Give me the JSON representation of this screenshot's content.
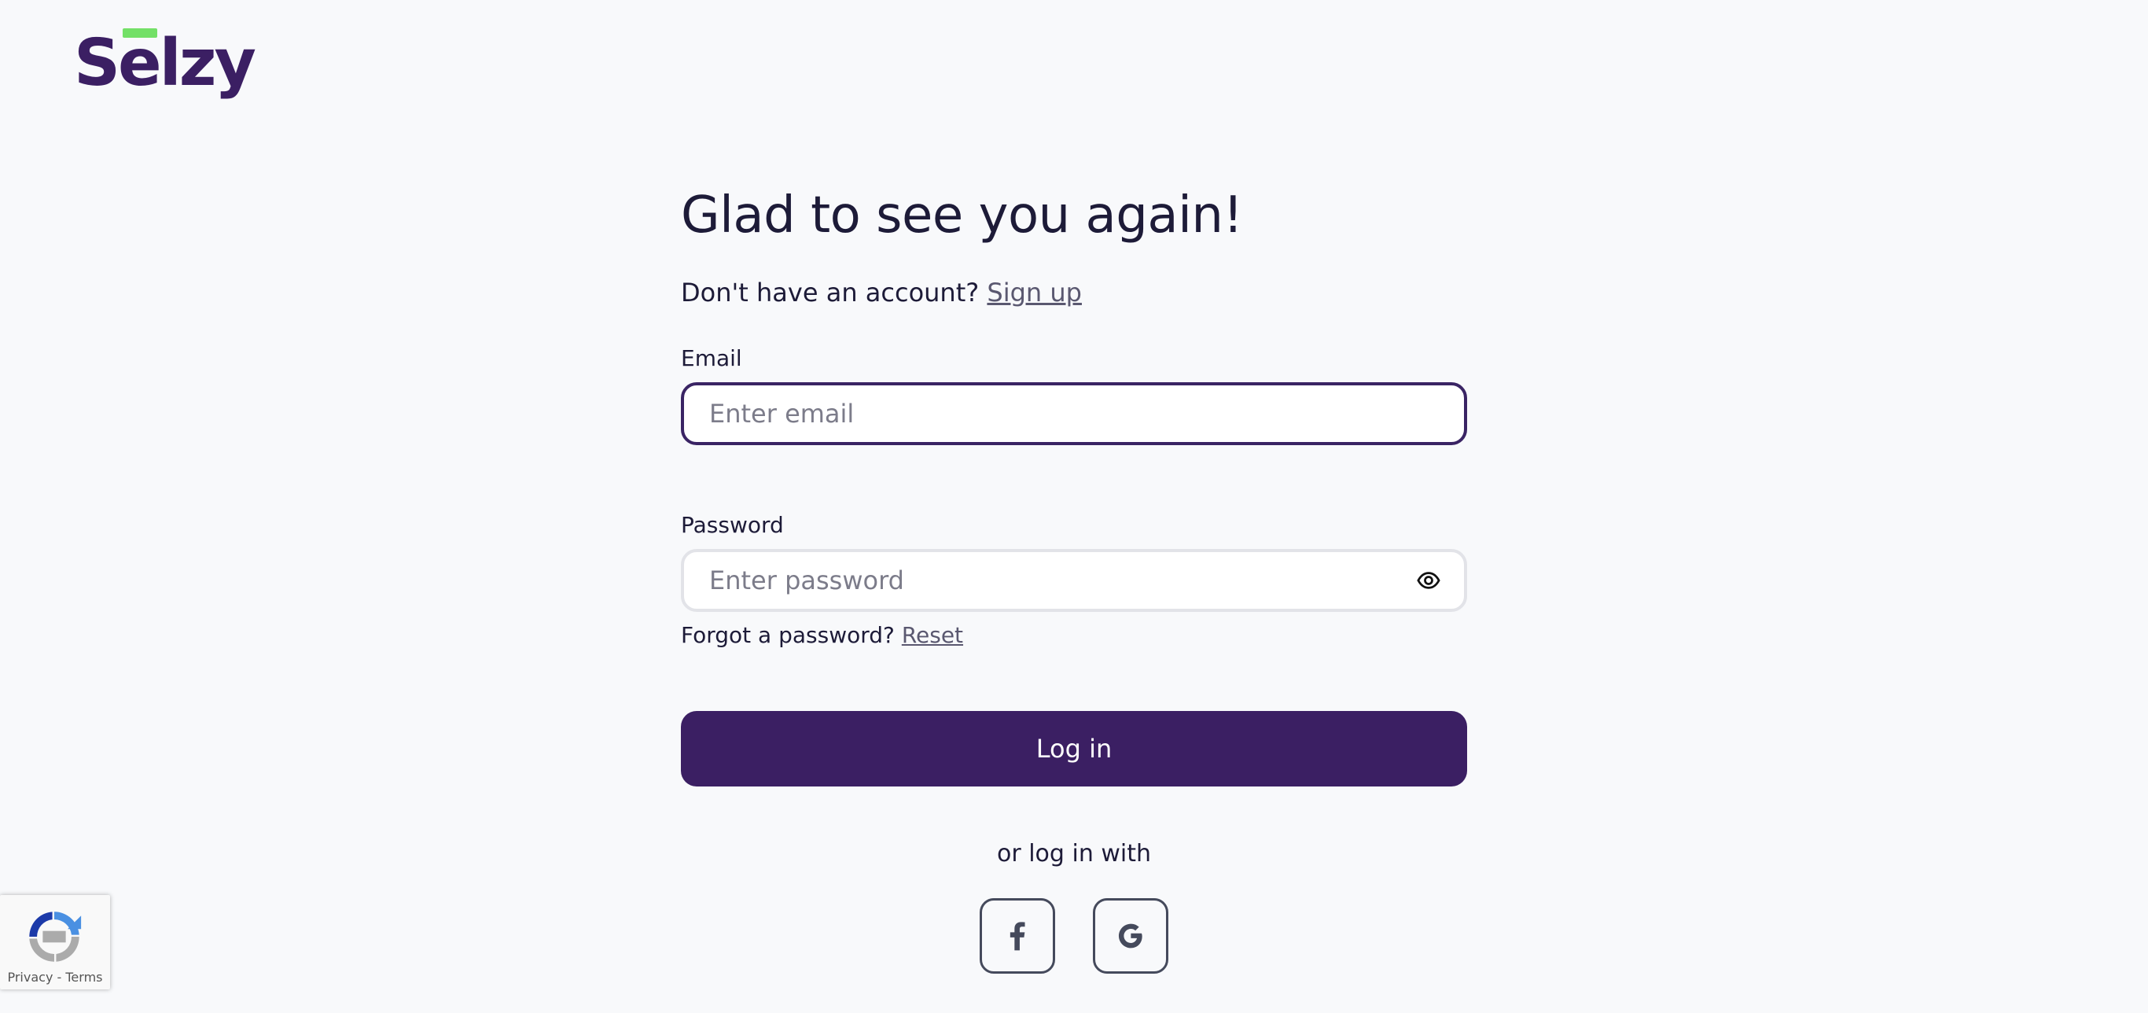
{
  "brand": {
    "name": "Selzy",
    "primary_color": "#3b1f63",
    "accent_color": "#73e067"
  },
  "heading": "Glad to see you again!",
  "signup": {
    "prompt": "Don't have an account?",
    "link": "Sign up"
  },
  "email": {
    "label": "Email",
    "placeholder": "Enter email",
    "value": ""
  },
  "password": {
    "label": "Password",
    "placeholder": "Enter password",
    "value": "",
    "toggle_icon": "eye-icon"
  },
  "forgot": {
    "prompt": "Forgot a password?",
    "link": "Reset"
  },
  "login_button": "Log in",
  "social": {
    "prompt": "or log in with",
    "providers": [
      {
        "name": "facebook",
        "icon": "facebook-icon"
      },
      {
        "name": "google",
        "icon": "google-icon"
      }
    ]
  },
  "recaptcha": {
    "privacy": "Privacy",
    "separator": " - ",
    "terms": "Terms"
  }
}
